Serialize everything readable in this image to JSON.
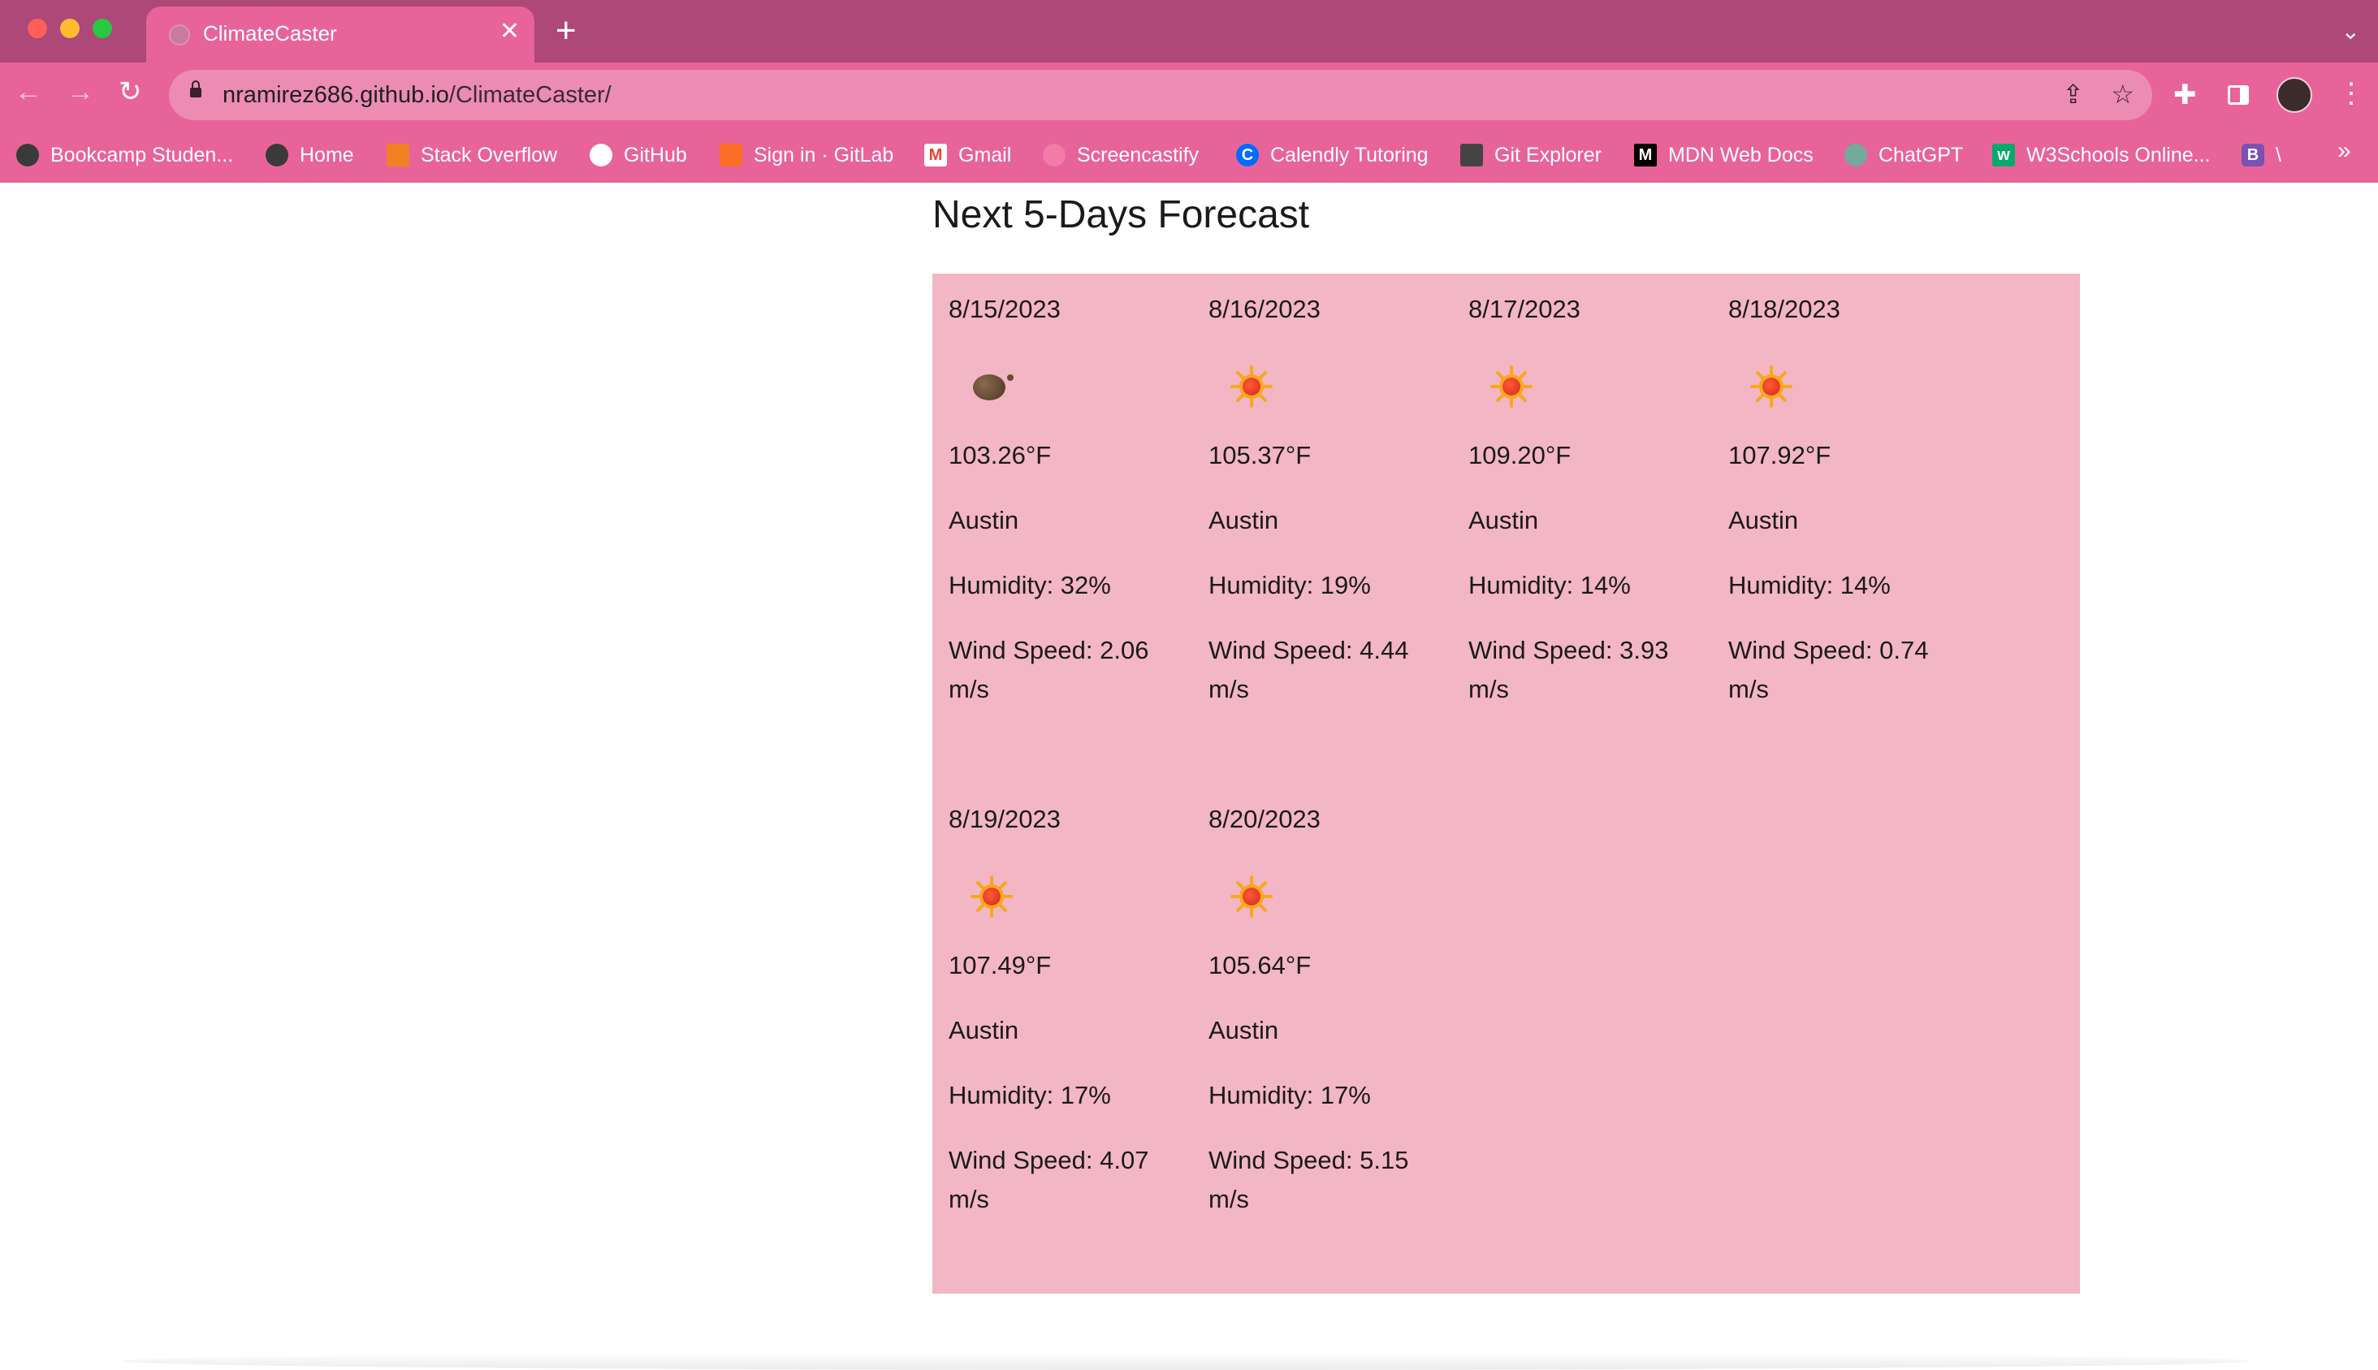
{
  "browser": {
    "tab_title": "ClimateCaster",
    "tab_close": "✕",
    "new_tab": "+",
    "url_host": "nramirez686.github.io",
    "url_path": "/ClimateCaster/",
    "bookmarks": [
      {
        "label": "Bookcamp Studen...",
        "icon": "globe-icon",
        "color": "#3a3a3a"
      },
      {
        "label": "Home",
        "icon": "globe-icon",
        "color": "#3a3a3a"
      },
      {
        "label": "Stack Overflow",
        "icon": "stackoverflow-icon",
        "color": "#f48024"
      },
      {
        "label": "GitHub",
        "icon": "github-icon",
        "color": "#ffffff"
      },
      {
        "label": "Sign in · GitLab",
        "icon": "gitlab-icon",
        "color": "#fc6d26"
      },
      {
        "label": "Gmail",
        "icon": "gmail-icon",
        "color": "#ea4335"
      },
      {
        "label": "Screencastify",
        "icon": "screencastify-icon",
        "color": "#f27ba8"
      },
      {
        "label": "Calendly Tutoring",
        "icon": "calendly-icon",
        "color": "#006bff"
      },
      {
        "label": "Git Explorer",
        "icon": "git-explorer-icon",
        "color": "#444444"
      },
      {
        "label": "MDN Web Docs",
        "icon": "mdn-icon",
        "color": "#000000"
      },
      {
        "label": "ChatGPT",
        "icon": "chatgpt-icon",
        "color": "#74aa9c"
      },
      {
        "label": "W3Schools Online...",
        "icon": "w3schools-icon",
        "color": "#04aa6d"
      },
      {
        "label": "\\",
        "icon": "bootstrap-icon",
        "color": "#7952b3"
      }
    ],
    "bookmarks_more": "»"
  },
  "page": {
    "heading": "Next 5-Days Forecast",
    "panel_color": "#f3b6c5",
    "forecast": [
      {
        "date": "8/15/2023",
        "icon": "moon-icon",
        "temp": "103.26°F",
        "city": "Austin",
        "humidity": "Humidity: 32%",
        "wind": "Wind Speed: 2.06 m/s"
      },
      {
        "date": "8/16/2023",
        "icon": "sun-icon",
        "temp": "105.37°F",
        "city": "Austin",
        "humidity": "Humidity: 19%",
        "wind": "Wind Speed: 4.44 m/s"
      },
      {
        "date": "8/17/2023",
        "icon": "sun-icon",
        "temp": "109.20°F",
        "city": "Austin",
        "humidity": "Humidity: 14%",
        "wind": "Wind Speed: 3.93 m/s"
      },
      {
        "date": "8/18/2023",
        "icon": "sun-icon",
        "temp": "107.92°F",
        "city": "Austin",
        "humidity": "Humidity: 14%",
        "wind": "Wind Speed: 0.74 m/s"
      },
      {
        "date": "8/19/2023",
        "icon": "sun-icon",
        "temp": "107.49°F",
        "city": "Austin",
        "humidity": "Humidity: 17%",
        "wind": "Wind Speed: 4.07 m/s"
      },
      {
        "date": "8/20/2023",
        "icon": "sun-icon",
        "temp": "105.64°F",
        "city": "Austin",
        "humidity": "Humidity: 17%",
        "wind": "Wind Speed: 5.15 m/s"
      }
    ]
  }
}
